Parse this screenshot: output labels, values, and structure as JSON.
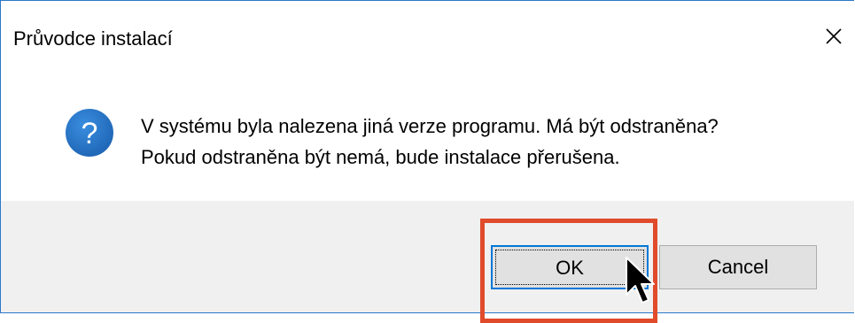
{
  "dialog": {
    "title": "Průvodce instalací",
    "close_icon": "close-icon",
    "icon": "question-icon",
    "message_line1": "V systému byla nalezena jiná verze programu. Má být odstraněna?",
    "message_line2": "Pokud odstraněna být nemá, bude instalace přerušena.",
    "ok_label": "OK",
    "cancel_label": "Cancel"
  },
  "annotation": {
    "highlight_color": "#e04b2b",
    "highlight_target": "ok-button"
  },
  "colors": {
    "accent": "#0078d7",
    "icon_blue": "#1e74c8",
    "footer_bg": "#f0f0f0"
  }
}
